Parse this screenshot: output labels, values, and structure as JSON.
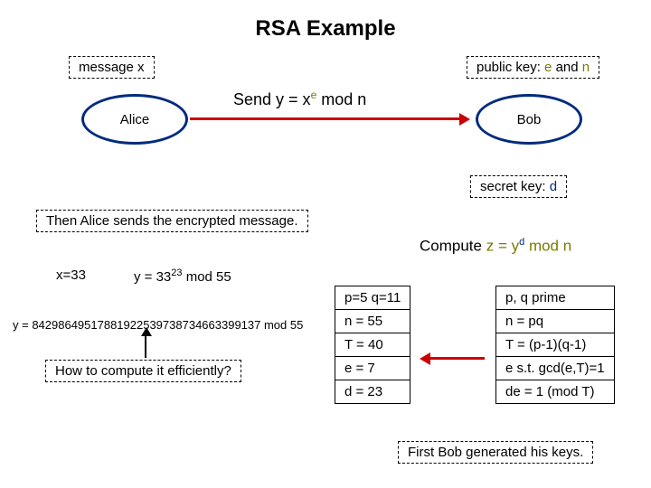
{
  "title": "RSA Example",
  "msg_x": "message x",
  "public_key_label": "public key:",
  "public_key_e": "e",
  "public_key_and": "and",
  "public_key_n": "n",
  "send_label": "Send y = x",
  "send_exp": "e",
  "send_tail": " mod n",
  "alice": "Alice",
  "bob": "Bob",
  "secret_key_label": "secret key:",
  "secret_key_d": "d",
  "alice_sends": "Then Alice sends the encrypted message.",
  "compute_label": "Compute",
  "compute_expr_pre": "z = y",
  "compute_expr_exp": "d",
  "compute_expr_post": " mod n",
  "x33": "x=33",
  "y_calc_pre": "y = 33",
  "y_calc_exp": "23",
  "y_calc_post": " mod 55",
  "y_big": "y = 84298649517881922539738734663399137 mod 55",
  "howto": "How to compute it efficiently?",
  "left_table": {
    "r1": "p=5 q=11",
    "r2": "n = 55",
    "r3": "T = 40",
    "r4": "e = 7",
    "r5": "d = 23"
  },
  "right_table": {
    "r1": "p, q prime",
    "r2": "n = pq",
    "r3": "T = (p-1)(q-1)",
    "r4": "e s.t. gcd(e,T)=1",
    "r5": "de = 1 (mod T)"
  },
  "first_bob": "First Bob generated his keys."
}
